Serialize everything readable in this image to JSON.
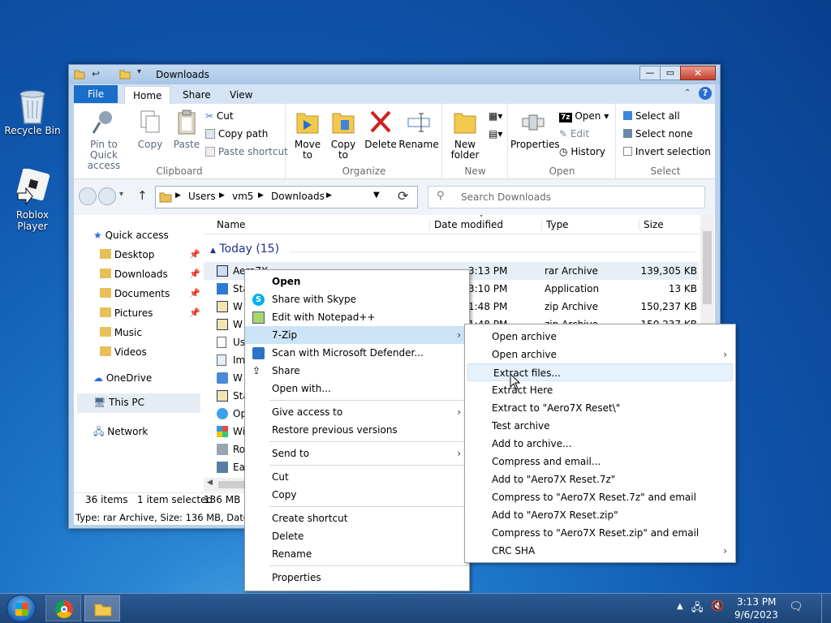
{
  "desktop": {
    "icons": [
      {
        "label": "Recycle Bin",
        "icon": "recycle-bin-icon"
      },
      {
        "label": "Roblox Player",
        "icon": "roblox-icon"
      }
    ]
  },
  "window": {
    "title": "Downloads",
    "ribbon_tabs": [
      "File",
      "Home",
      "Share",
      "View"
    ],
    "clipboard": {
      "pin_label": "Pin to Quick access",
      "copy": "Copy",
      "paste": "Paste",
      "cut": "Cut",
      "copy_path": "Copy path",
      "paste_shortcut": "Paste shortcut",
      "group": "Clipboard"
    },
    "organize": {
      "move_to": "Move to",
      "copy_to": "Copy to",
      "delete": "Delete",
      "rename": "Rename",
      "group": "Organize"
    },
    "new_group": {
      "new_folder": "New folder",
      "group": "New"
    },
    "open_group": {
      "properties": "Properties",
      "open": "Open",
      "edit": "Edit",
      "history": "History",
      "group": "Open"
    },
    "select_group": {
      "select_all": "Select all",
      "select_none": "Select none",
      "invert": "Invert selection",
      "group": "Select"
    },
    "address": {
      "parts": [
        "Users",
        "vm5",
        "Downloads"
      ]
    },
    "search_placeholder": "Search Downloads",
    "columns": {
      "name": "Name",
      "date": "Date modified",
      "type": "Type",
      "size": "Size"
    },
    "group_header": "Today (15)",
    "nav": {
      "quick_access": "Quick access",
      "desktop": "Desktop",
      "downloads": "Downloads",
      "documents": "Documents",
      "pictures": "Pictures",
      "music": "Music",
      "videos": "Videos",
      "onedrive": "OneDrive",
      "thispc": "This PC",
      "network": "Network"
    },
    "files": [
      {
        "name": "Aero7X",
        "date": "3:13 PM",
        "type": "rar Archive",
        "size": "139,305 KB"
      },
      {
        "name": "Sta",
        "date": "3:10 PM",
        "type": "Application",
        "size": "13 KB"
      },
      {
        "name": "W",
        "date": "1:48 PM",
        "type": "zip Archive",
        "size": "150,237 KB"
      },
      {
        "name": "W",
        "date": "1:48 PM",
        "type": "zip Archive",
        "size": "150,237 KB"
      },
      {
        "name": "Us",
        "date": "",
        "type": "",
        "size": ""
      },
      {
        "name": "Im",
        "date": "",
        "type": "",
        "size": ""
      },
      {
        "name": "W",
        "date": "",
        "type": "",
        "size": ""
      },
      {
        "name": "Sta",
        "date": "",
        "type": "",
        "size": ""
      },
      {
        "name": "Op",
        "date": "",
        "type": "",
        "size": ""
      },
      {
        "name": "Wi",
        "date": "",
        "type": "",
        "size": ""
      },
      {
        "name": "Ro",
        "date": "",
        "type": "",
        "size": ""
      },
      {
        "name": "Ea",
        "date": "",
        "type": "",
        "size": ""
      }
    ],
    "status": {
      "items": "36 items",
      "selected": "1 item selected",
      "size": "136 MB",
      "details": "Type: rar Archive, Size: 136 MB, Date mo"
    }
  },
  "context_menu": {
    "open": "Open",
    "skype": "Share with Skype",
    "notepad": "Edit with Notepad++",
    "sevenzip": "7-Zip",
    "defender": "Scan with Microsoft Defender...",
    "share": "Share",
    "open_with": "Open with...",
    "give_access": "Give access to",
    "restore": "Restore previous versions",
    "send_to": "Send to",
    "cut": "Cut",
    "copy": "Copy",
    "create_shortcut": "Create shortcut",
    "delete": "Delete",
    "rename": "Rename",
    "properties": "Properties"
  },
  "submenu": {
    "items": [
      "Open archive",
      "Open archive",
      "Extract files...",
      "Extract Here",
      "Extract to \"Aero7X Reset\\\"",
      "Test archive",
      "Add to archive...",
      "Compress and email...",
      "Add to \"Aero7X Reset.7z\"",
      "Compress to \"Aero7X Reset.7z\" and email",
      "Add to \"Aero7X Reset.zip\"",
      "Compress to \"Aero7X Reset.zip\" and email",
      "CRC SHA"
    ]
  },
  "taskbar": {
    "time": "3:13 PM",
    "date": "9/6/2023"
  }
}
